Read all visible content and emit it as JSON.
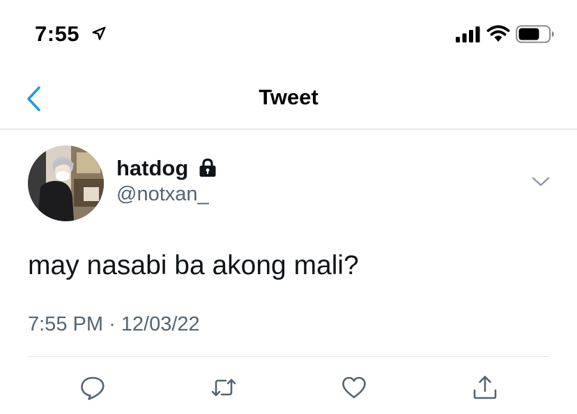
{
  "status_bar": {
    "time": "7:55",
    "icons": [
      "location-arrow-icon",
      "cellular-signal-icon",
      "wifi-icon",
      "battery-icon"
    ]
  },
  "nav": {
    "title": "Tweet",
    "back_icon": "chevron-left-icon"
  },
  "colors": {
    "accent": "#1d9bf0",
    "secondary_text": "#536471",
    "primary_text": "#0f1419"
  },
  "tweet": {
    "author": {
      "display_name": "hatdog",
      "handle": "@notxan_",
      "protected_icon": "lock-icon"
    },
    "text": "may nasabi ba akong mali?",
    "time": "7:55 PM",
    "separator": "·",
    "date": "12/03/22",
    "actions": [
      "reply-icon",
      "retweet-icon",
      "like-icon",
      "share-icon"
    ]
  }
}
